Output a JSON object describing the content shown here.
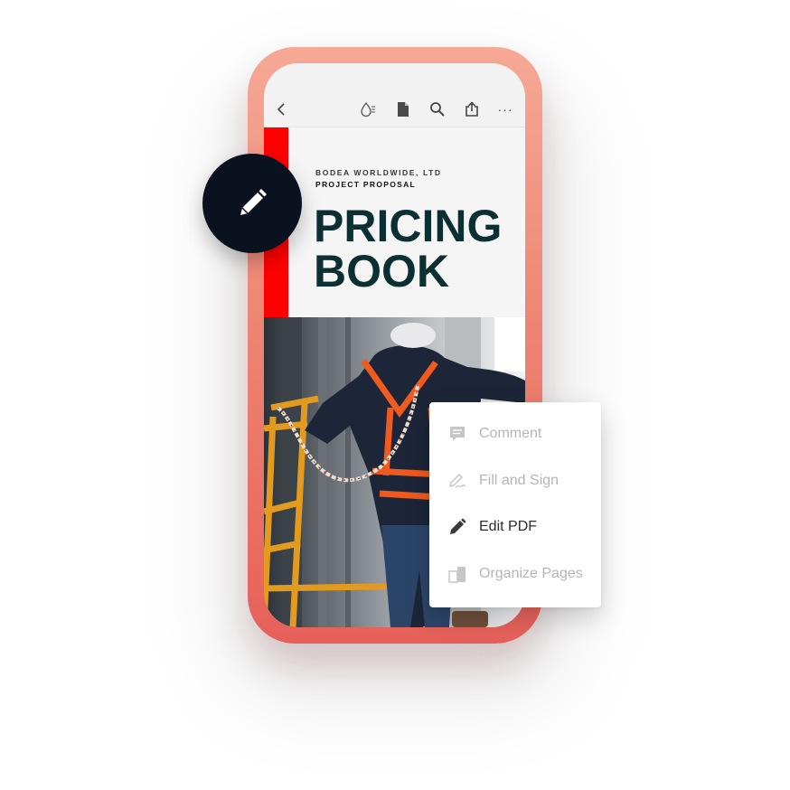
{
  "document": {
    "company": "BODEA WORLDWIDE, LTD",
    "subtitle": "PROJECT PROPOSAL",
    "title_line1": "PRICING",
    "title_line2": "BOOK"
  },
  "toolbar": {
    "icons": [
      "back-icon",
      "liquid-mode-icon",
      "document-icon",
      "search-icon",
      "share-icon",
      "more-icon"
    ],
    "more_label": "···"
  },
  "menu": {
    "items": [
      {
        "label": "Comment",
        "icon": "comment-icon",
        "active": false
      },
      {
        "label": "Fill and Sign",
        "icon": "fill-sign-icon",
        "active": false
      },
      {
        "label": "Edit PDF",
        "icon": "pencil-icon",
        "active": true
      },
      {
        "label": "Organize Pages",
        "icon": "organize-pages-icon",
        "active": false
      }
    ]
  },
  "colors": {
    "phone_frame": "#ee8674",
    "accent_red": "#ff0000",
    "title_color": "#0b2f33",
    "badge": "#0a1220"
  }
}
